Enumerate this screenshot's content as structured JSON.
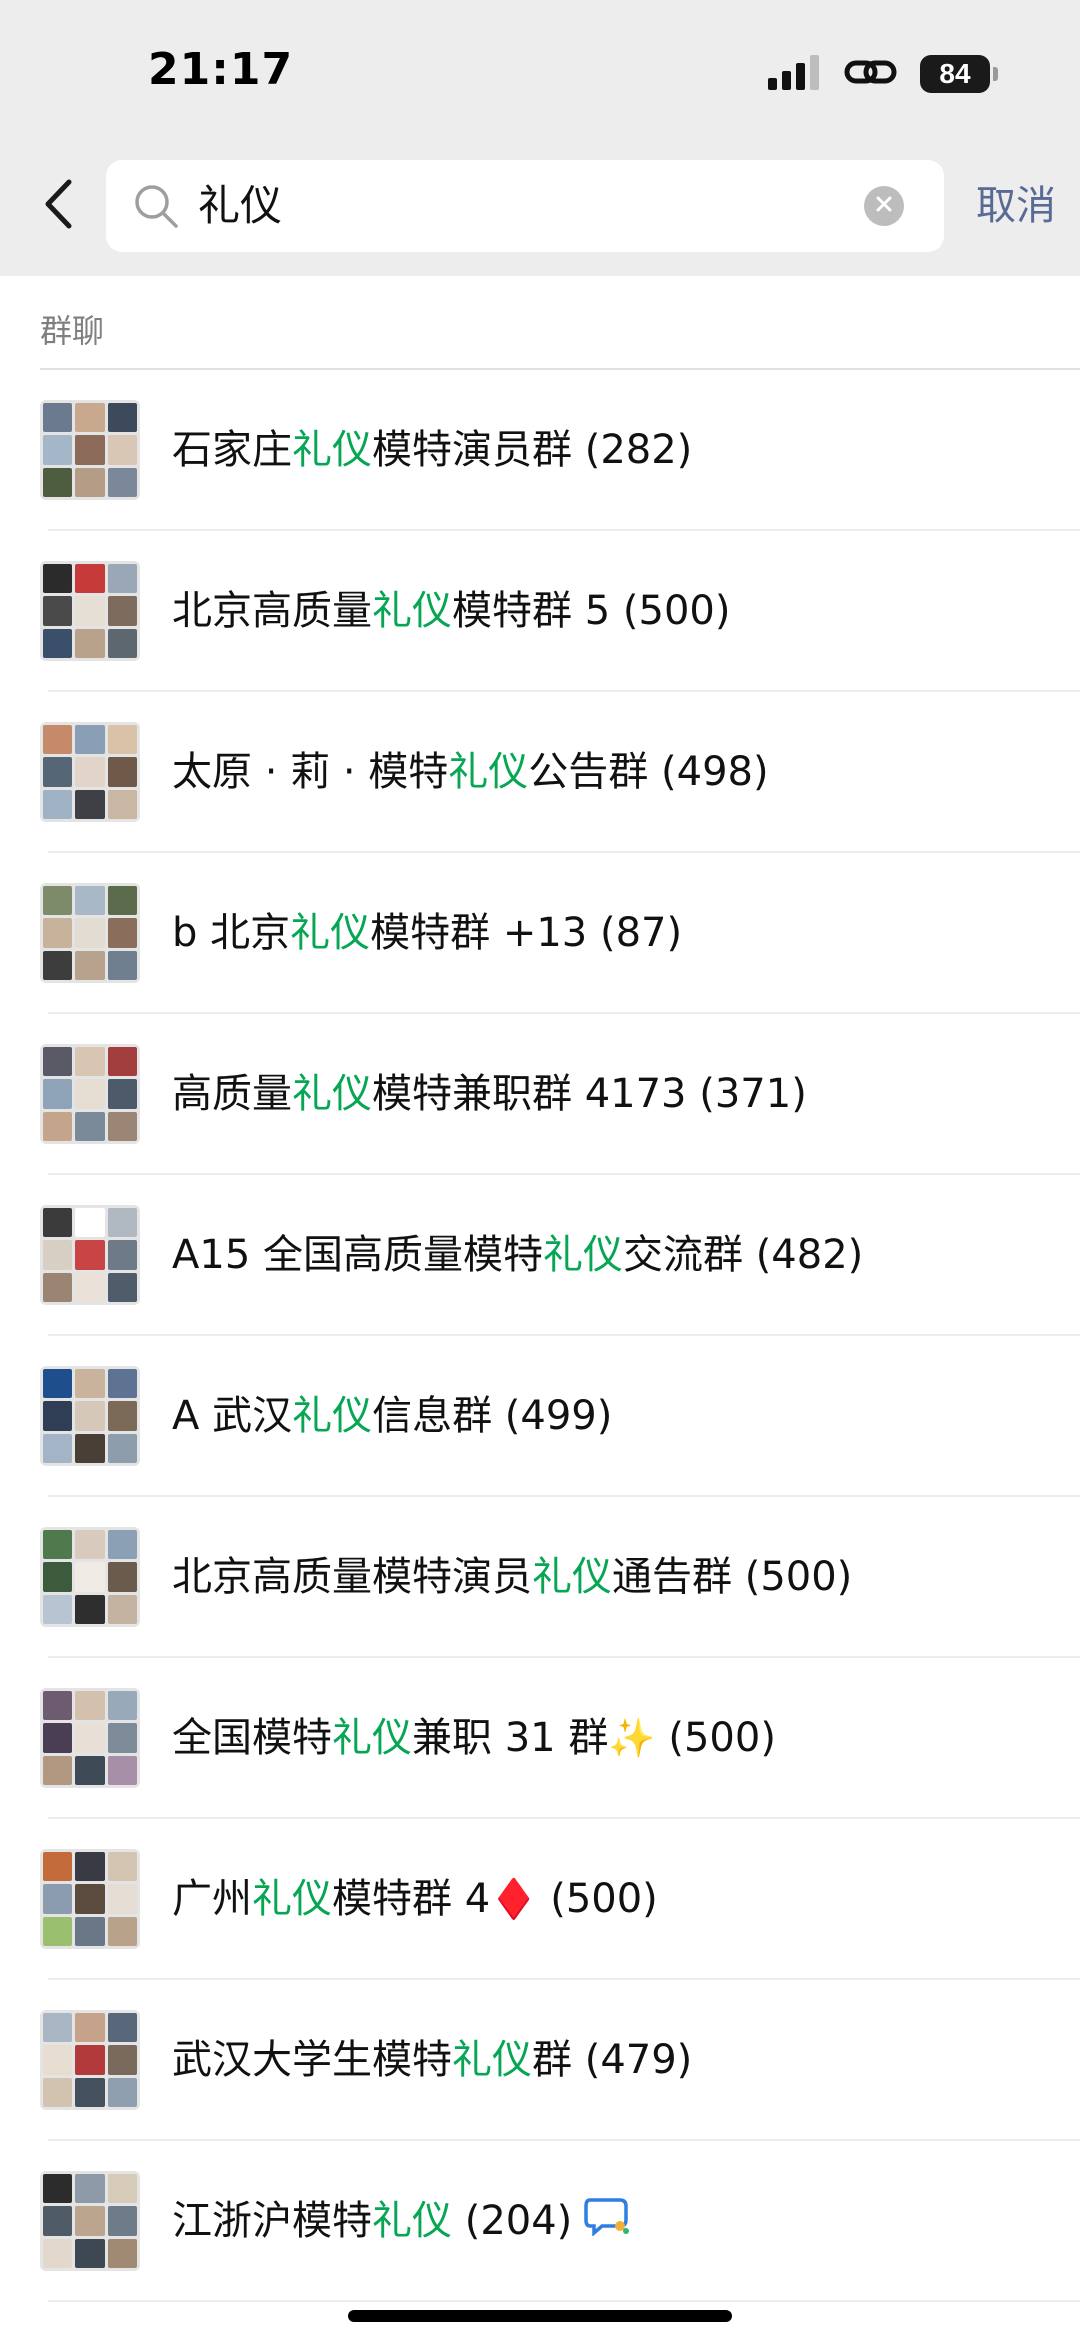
{
  "status_bar": {
    "time": "21:17",
    "battery": "84",
    "signal_icon": "cellular-signal-icon",
    "link_icon": "link-icon"
  },
  "search": {
    "query": "礼仪",
    "cancel_label": "取消",
    "back_icon": "chevron-left-icon",
    "search_icon": "search-icon",
    "clear_icon": "clear-circle-icon"
  },
  "section": {
    "title": "群聊"
  },
  "highlight_color": "#07a654",
  "groups": [
    {
      "before": "石家庄",
      "match": "礼仪",
      "after": "模特演员群",
      "emoji": "",
      "count": "(282)"
    },
    {
      "before": "北京高质量",
      "match": "礼仪",
      "after": "模特群 5",
      "emoji": "",
      "count": "(500)"
    },
    {
      "before": "太原 · 莉 · 模特",
      "match": "礼仪",
      "after": "公告群",
      "emoji": "",
      "count": "(498)"
    },
    {
      "before": "b 北京",
      "match": "礼仪",
      "after": "模特群 +13",
      "emoji": "",
      "count": "(87)"
    },
    {
      "before": "高质量",
      "match": "礼仪",
      "after": "模特兼职群 4173",
      "emoji": "",
      "count": "(371)"
    },
    {
      "before": "A15 全国高质量模特",
      "match": "礼仪",
      "after": "交流群",
      "emoji": "",
      "count": "(482)"
    },
    {
      "before": "A 武汉",
      "match": "礼仪",
      "after": "信息群",
      "emoji": "",
      "count": "(499)"
    },
    {
      "before": "北京高质量模特演员",
      "match": "礼仪",
      "after": "通告群",
      "emoji": "",
      "count": "(500)"
    },
    {
      "before": "全国模特",
      "match": "礼仪",
      "after": "兼职 31 群",
      "emoji": "✨",
      "count": "(500)"
    },
    {
      "before": "广州",
      "match": "礼仪",
      "after": "模特群 4",
      "emoji": "♦️",
      "count": "(500)"
    },
    {
      "before": "武汉大学生模特",
      "match": "礼仪",
      "after": "群",
      "emoji": "",
      "count": "(479)"
    },
    {
      "before": "江浙沪模特",
      "match": "礼仪",
      "after": "",
      "emoji": "",
      "count": "(204)",
      "trailing_icon": "chat-bubble-icon"
    }
  ]
}
